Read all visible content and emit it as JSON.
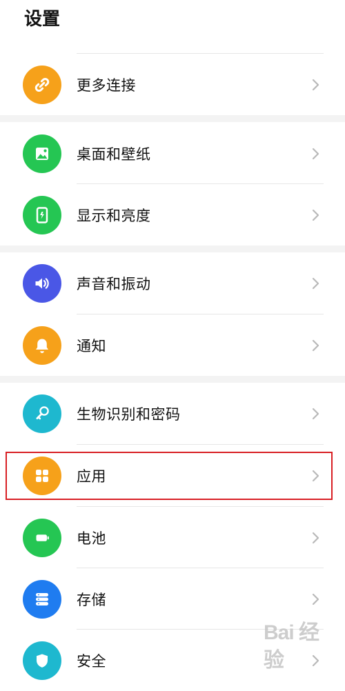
{
  "header": {
    "title": "设置"
  },
  "settings": {
    "items": [
      {
        "label": "更多连接",
        "icon": "link-icon",
        "color": "#f6a11a"
      },
      {
        "label": "桌面和壁纸",
        "icon": "wallpaper-icon",
        "color": "#25c653"
      },
      {
        "label": "显示和亮度",
        "icon": "phone-brightness-icon",
        "color": "#25c653"
      },
      {
        "label": "声音和振动",
        "icon": "volume-icon",
        "color": "#4a57e6"
      },
      {
        "label": "通知",
        "icon": "bell-icon",
        "color": "#f6a11a"
      },
      {
        "label": "生物识别和密码",
        "icon": "key-icon",
        "color": "#1eb8cf"
      },
      {
        "label": "应用",
        "icon": "apps-icon",
        "color": "#f6a11a"
      },
      {
        "label": "电池",
        "icon": "battery-icon",
        "color": "#25c653"
      },
      {
        "label": "存储",
        "icon": "storage-icon",
        "color": "#1f7cf0"
      },
      {
        "label": "安全",
        "icon": "shield-icon",
        "color": "#1eb8cf"
      }
    ]
  },
  "watermark": {
    "text": "Bai 经验"
  }
}
